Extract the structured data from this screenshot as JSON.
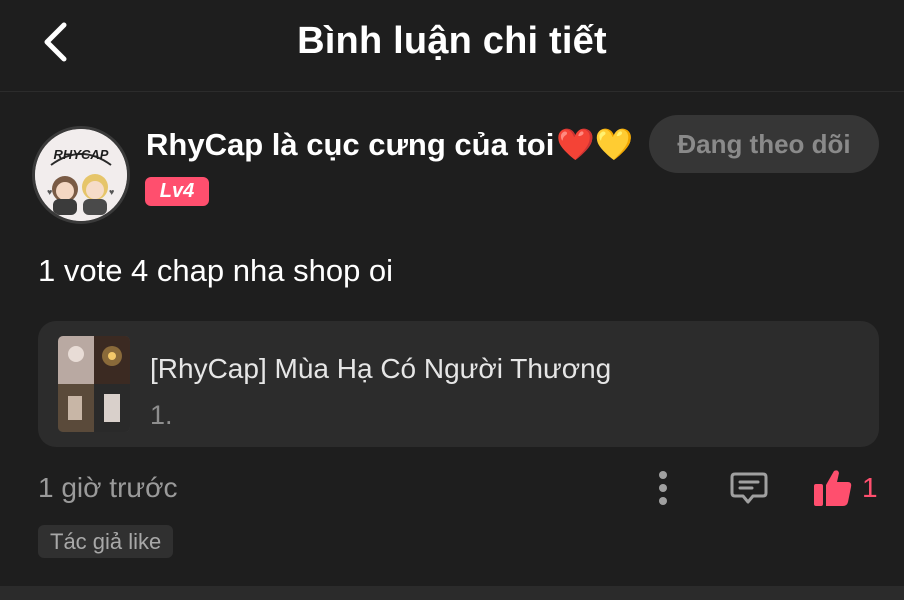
{
  "header": {
    "title": "Bình luận chi tiết",
    "back_icon": "chevron-left-icon"
  },
  "comment": {
    "username": "RhyCap là cục cưng của toi",
    "username_emoji": "❤️💛",
    "level": "Lv4",
    "avatar_text": "RHYCAP",
    "follow_label": "Đang theo dõi",
    "text": "1 vote 4 chap nha shop oi",
    "time": "1 giờ trước",
    "like_count": "1",
    "author_like": "Tác giả like"
  },
  "story": {
    "title": "[RhyCap] Mùa Hạ Có Người Thương",
    "chapter": "1."
  },
  "colors": {
    "background": "#1e1e1e",
    "card": "#2c2c2c",
    "accent": "#ff4f6e",
    "muted": "#9a9a9a"
  }
}
